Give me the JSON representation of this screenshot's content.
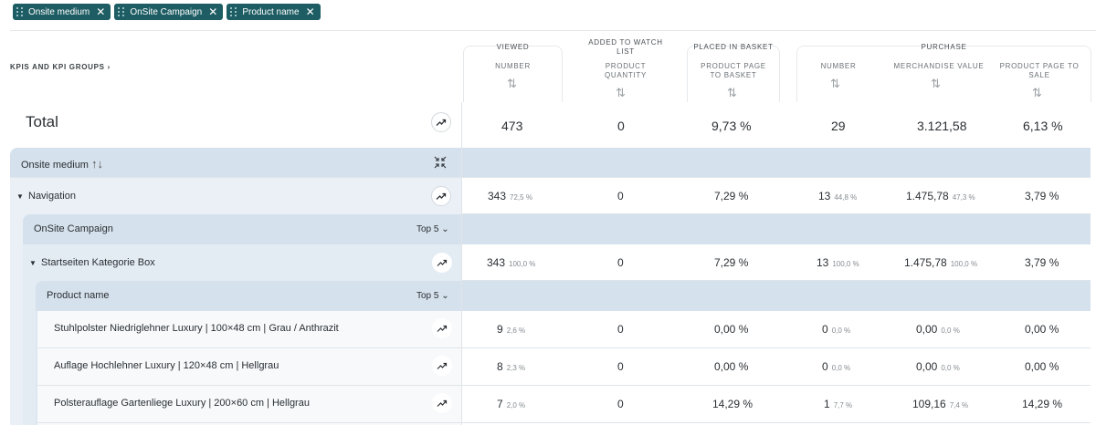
{
  "filters": [
    {
      "label": "Onsite medium"
    },
    {
      "label": "OnSite Campaign"
    },
    {
      "label": "Product name"
    }
  ],
  "header": {
    "kpis_label": "KPIS AND KPI GROUPS",
    "groups": {
      "viewed": "VIEWED",
      "watch_1": "ADDED TO WATCH",
      "watch_2": "LIST",
      "basket": "PLACED IN BASKET",
      "purchase": "PURCHASE"
    },
    "columns": {
      "number": "NUMBER",
      "pq_1": "PRODUCT",
      "pq_2": "QUANTITY",
      "ppb_1": "PRODUCT PAGE",
      "ppb_2": "TO BASKET",
      "pnum": "NUMBER",
      "mv": "MERCHANDISE VALUE",
      "pps_1": "PRODUCT PAGE TO",
      "pps_2": "SALE"
    }
  },
  "total": {
    "label": "Total",
    "viewed": "473",
    "watch": "0",
    "basket": "9,73 %",
    "number": "29",
    "mv": "3.121,58",
    "sale": "6,13 %"
  },
  "level1": {
    "label": "Onsite medium",
    "sort": "↑↓"
  },
  "nav": {
    "label": "Navigation",
    "viewed": "343",
    "viewed_pct": "72,5 %",
    "watch": "0",
    "basket": "7,29 %",
    "number": "13",
    "number_pct": "44,8 %",
    "mv": "1.475,78",
    "mv_pct": "47,3 %",
    "sale": "3,79 %"
  },
  "level2": {
    "label": "OnSite Campaign",
    "top": "Top 5"
  },
  "campaign": {
    "label": "Startseiten Kategorie Box",
    "viewed": "343",
    "viewed_pct": "100,0 %",
    "watch": "0",
    "basket": "7,29 %",
    "number": "13",
    "number_pct": "100,0 %",
    "mv": "1.475,78",
    "mv_pct": "100,0 %",
    "sale": "3,79 %"
  },
  "level3": {
    "label": "Product name",
    "top": "Top 5"
  },
  "products": [
    {
      "label": "Stuhlpolster Niedriglehner Luxury | 100×48 cm | Grau / Anthrazit",
      "viewed": "9",
      "viewed_pct": "2,6 %",
      "watch": "0",
      "basket": "0,00 %",
      "number": "0",
      "number_pct": "0,0 %",
      "mv": "0,00",
      "mv_pct": "0,0 %",
      "sale": "0,00 %"
    },
    {
      "label": "Auflage Hochlehner Luxury | 120×48 cm | Hellgrau",
      "viewed": "8",
      "viewed_pct": "2,3 %",
      "watch": "0",
      "basket": "0,00 %",
      "number": "0",
      "number_pct": "0,0 %",
      "mv": "0,00",
      "mv_pct": "0,0 %",
      "sale": "0,00 %"
    },
    {
      "label": "Polsterauflage Gartenliege Luxury | 200×60 cm | Hellgrau",
      "viewed": "7",
      "viewed_pct": "2,0 %",
      "watch": "0",
      "basket": "14,29 %",
      "number": "1",
      "number_pct": "7,7 %",
      "mv": "109,16",
      "mv_pct": "7,4 %",
      "sale": "14,29 %"
    }
  ],
  "icons": {
    "close": "close-icon",
    "drag": "drag-handle-icon",
    "trend": "trend-icon",
    "sort": "sort-icon",
    "collapse": "collapse-icon",
    "chevron": "chevron-down-icon"
  },
  "colors": {
    "chip": "#1d5d63",
    "panel": "#eaf0f6",
    "bar": "#d5e1ec"
  }
}
